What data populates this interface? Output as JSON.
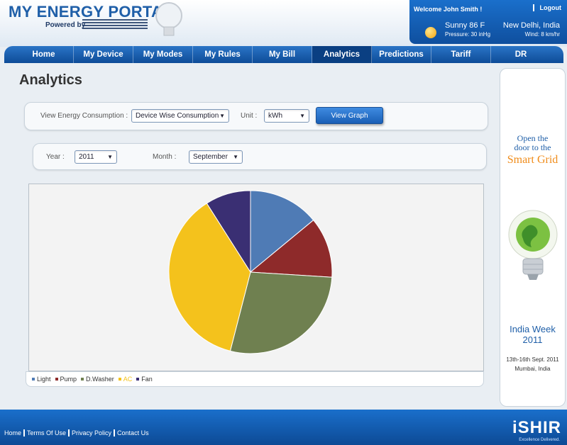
{
  "header": {
    "app_title": "MY ENERGY PORTAL",
    "powered_by": "Powered by",
    "welcome": "Welcome John Smith !",
    "logout": "Logout",
    "weather": {
      "description": "Sunny 86 F",
      "location": "New Delhi, India",
      "pressure": "Pressure: 30 inHg",
      "wind": "Wind: 8 km/hr"
    }
  },
  "nav": {
    "items": [
      {
        "label": "Home"
      },
      {
        "label": "My Device"
      },
      {
        "label": "My Modes"
      },
      {
        "label": "My Rules"
      },
      {
        "label": "My Bill"
      },
      {
        "label": "Analytics"
      },
      {
        "label": "Predictions"
      },
      {
        "label": "Tariff"
      },
      {
        "label": "DR"
      }
    ],
    "active": "Analytics"
  },
  "page": {
    "title": "Analytics",
    "filters": {
      "view_label": "View Energy Consumption :",
      "view_value": "Device Wise Consumption",
      "unit_label": "Unit :",
      "unit_value": "kWh",
      "view_graph_button": "View Graph",
      "year_label": "Year :",
      "year_value": "2011",
      "month_label": "Month :",
      "month_value": "September"
    }
  },
  "chart_data": {
    "type": "pie",
    "categories": [
      "Light",
      "Pump",
      "D.Washer",
      "AC",
      "Fan"
    ],
    "values": [
      14,
      12,
      28,
      37,
      9
    ],
    "colors": [
      "#4f7bb5",
      "#8e2a2a",
      "#6f8050",
      "#f4c21c",
      "#3a2f73"
    ]
  },
  "ad": {
    "line1": "Open the",
    "line2": "door to the",
    "line3": "Smart Grid",
    "event": "India Week",
    "event_year": "2011",
    "dates": "13th-16th Sept. 2011",
    "city": "Mumbai, India"
  },
  "footer": {
    "links": [
      "Home",
      "Terms Of Use",
      "Privacy Policy",
      "Contact Us"
    ],
    "brand": "iSHIR",
    "tagline": "Excellence Delivered."
  }
}
